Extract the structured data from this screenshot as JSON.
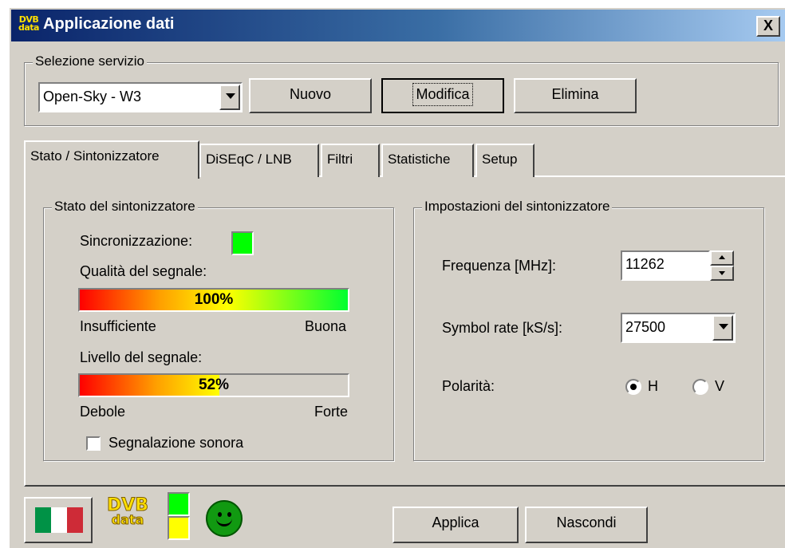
{
  "window": {
    "title": "Applicazione dati",
    "title_logo": [
      "DVB",
      "data"
    ],
    "close_symbol": "X"
  },
  "service": {
    "group_label": "Selezione servizio",
    "selected": "Open-Sky - W3",
    "new_label": "Nuovo",
    "edit_label": "Modifica",
    "delete_label": "Elimina"
  },
  "tabs": [
    {
      "label": "Stato / Sintonizzatore",
      "active": true
    },
    {
      "label": "DiSEqC / LNB",
      "active": false
    },
    {
      "label": "Filtri",
      "active": false
    },
    {
      "label": "Statistiche",
      "active": false
    },
    {
      "label": "Setup",
      "active": false
    }
  ],
  "tuner_status": {
    "group_label": "Stato del sintonizzatore",
    "sync_label": "Sincronizzazione:",
    "sync_color": "#00ff00",
    "quality": {
      "label": "Qualità del segnale:",
      "value": 100,
      "value_text": "100%",
      "min_label": "Insufficiente",
      "max_label": "Buona"
    },
    "level": {
      "label": "Livello del segnale:",
      "value": 52,
      "value_text": "52%",
      "min_label": "Debole",
      "max_label": "Forte"
    },
    "sound_alert": {
      "label": "Segnalazione sonora",
      "checked": false
    }
  },
  "tuner_settings": {
    "group_label": "Impostazioni del sintonizzatore",
    "frequency_label": "Frequenza [MHz]:",
    "frequency_value": "11262",
    "symbol_rate_label": "Symbol rate [kS/s]:",
    "symbol_rate_value": "27500",
    "polarity_label": "Polarità:",
    "polarity_options": [
      "H",
      "V"
    ],
    "polarity_selected": "H"
  },
  "footer": {
    "flag_icon": "italy-flag-icon",
    "logo_lines": [
      "DVB",
      "data"
    ],
    "indicator_colors": [
      "#00ff00",
      "#ffff00"
    ],
    "status_icon": "smiley-icon",
    "apply_label": "Applica",
    "hide_label": "Nascondi"
  }
}
